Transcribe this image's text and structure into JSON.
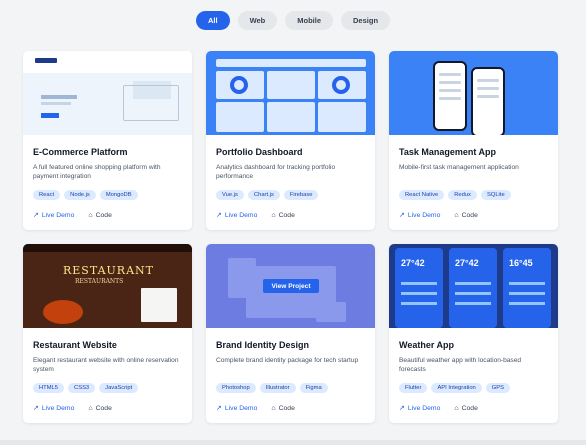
{
  "filters": [
    {
      "label": "All",
      "active": true
    },
    {
      "label": "Web",
      "active": false
    },
    {
      "label": "Mobile",
      "active": false
    },
    {
      "label": "Design",
      "active": false
    }
  ],
  "projects": [
    {
      "title": "E-Commerce Platform",
      "description": "A full featured online shopping platform with payment integration",
      "tags": [
        "React",
        "Node.js",
        "MongoDB"
      ],
      "demo_label": "Live Demo",
      "code_label": "Code",
      "thumb_text": []
    },
    {
      "title": "Portfolio Dashboard",
      "description": "Analytics dashboard for tracking portfolio performance",
      "tags": [
        "Vue.js",
        "Chart.js",
        "Firebase"
      ],
      "demo_label": "Live Demo",
      "code_label": "Code"
    },
    {
      "title": "Task Management App",
      "description": "Mobile-first task management application",
      "tags": [
        "React Native",
        "Redux",
        "SQLite"
      ],
      "demo_label": "Live Demo",
      "code_label": "Code"
    },
    {
      "title": "Restaurant Website",
      "description": "Elegant restaurant website with online reservation system",
      "tags": [
        "HTML5",
        "CSS3",
        "JavaScript"
      ],
      "demo_label": "Live Demo",
      "code_label": "Code",
      "thumb_title": "RESTAURANT",
      "thumb_sub": "RESTAURANTS"
    },
    {
      "title": "Brand Identity Design",
      "description": "Complete brand identity package for tech startup",
      "tags": [
        "Photoshop",
        "Illustrator",
        "Figma"
      ],
      "demo_label": "Live Demo",
      "code_label": "Code",
      "overlay_label": "View Project"
    },
    {
      "title": "Weather App",
      "description": "Beautiful weather app with location-based forecasts",
      "tags": [
        "Flutter",
        "API Integration",
        "GPS"
      ],
      "demo_label": "Live Demo",
      "code_label": "Code",
      "temps": [
        "27°42",
        "27°42",
        "16°45"
      ]
    }
  ],
  "colors": {
    "accent": "#2563eb",
    "tag_bg": "#dbeafe",
    "page_bg": "#f3f4f6"
  },
  "icons": {
    "demo": "external-link-icon",
    "code": "code-icon"
  }
}
